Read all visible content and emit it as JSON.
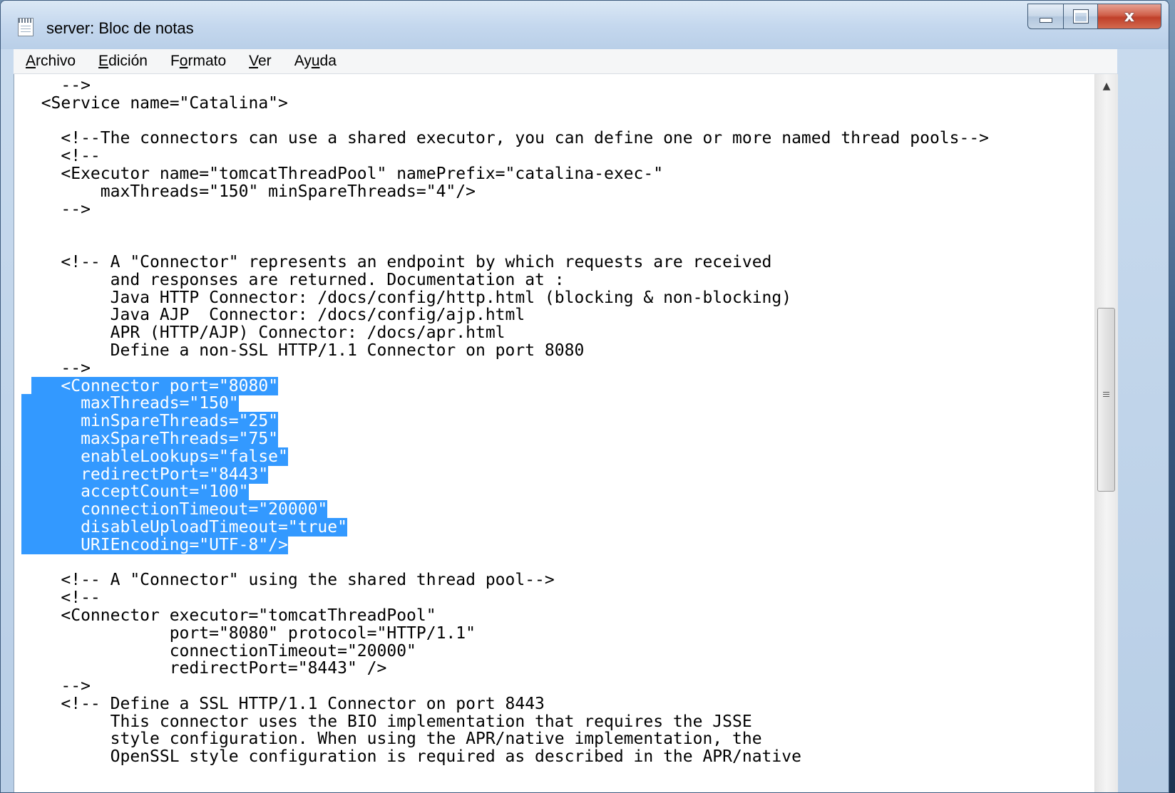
{
  "window": {
    "title": "server: Bloc de notas",
    "icon": "notepad-icon",
    "controls": {
      "minimize": "minimize-icon",
      "maximize": "maximize-icon",
      "close_label": "x"
    }
  },
  "menu": [
    {
      "pre": "",
      "ul": "A",
      "post": "rchivo"
    },
    {
      "pre": "",
      "ul": "E",
      "post": "dición"
    },
    {
      "pre": "F",
      "ul": "o",
      "post": "rmato"
    },
    {
      "pre": "",
      "ul": "V",
      "post": "er"
    },
    {
      "pre": "Ay",
      "ul": "u",
      "post": "da"
    }
  ],
  "editor": {
    "lines": [
      "    -->",
      "  <Service name=\"Catalina\">",
      "",
      "    <!--The connectors can use a shared executor, you can define one or more named thread pools-->",
      "    <!--",
      "    <Executor name=\"tomcatThreadPool\" namePrefix=\"catalina-exec-\"",
      "        maxThreads=\"150\" minSpareThreads=\"4\"/>",
      "    -->",
      "",
      "",
      "    <!-- A \"Connector\" represents an endpoint by which requests are received",
      "         and responses are returned. Documentation at :",
      "         Java HTTP Connector: /docs/config/http.html (blocking & non-blocking)",
      "         Java AJP  Connector: /docs/config/ajp.html",
      "         APR (HTTP/AJP) Connector: /docs/apr.html",
      "         Define a non-SSL HTTP/1.1 Connector on port 8080",
      "    -->",
      "    <Connector port=\"8080\"",
      "      maxThreads=\"150\"",
      "      minSpareThreads=\"25\"",
      "      maxSpareThreads=\"75\"",
      "      enableLookups=\"false\"",
      "      redirectPort=\"8443\"",
      "      acceptCount=\"100\"",
      "      connectionTimeout=\"20000\"",
      "      disableUploadTimeout=\"true\"",
      "      URIEncoding=\"UTF-8\"/>",
      "",
      "    <!-- A \"Connector\" using the shared thread pool-->",
      "    <!--",
      "    <Connector executor=\"tomcatThreadPool\"",
      "               port=\"8080\" protocol=\"HTTP/1.1\"",
      "               connectionTimeout=\"20000\"",
      "               redirectPort=\"8443\" />",
      "    -->",
      "    <!-- Define a SSL HTTP/1.1 Connector on port 8443",
      "         This connector uses the BIO implementation that requires the JSSE",
      "         style configuration. When using the APR/native implementation, the",
      "         OpenSSL style configuration is required as described in the APR/native"
    ],
    "selected_line_start": 17,
    "selected_line_end": 26
  },
  "scrollbar": {
    "position": 0.41
  }
}
